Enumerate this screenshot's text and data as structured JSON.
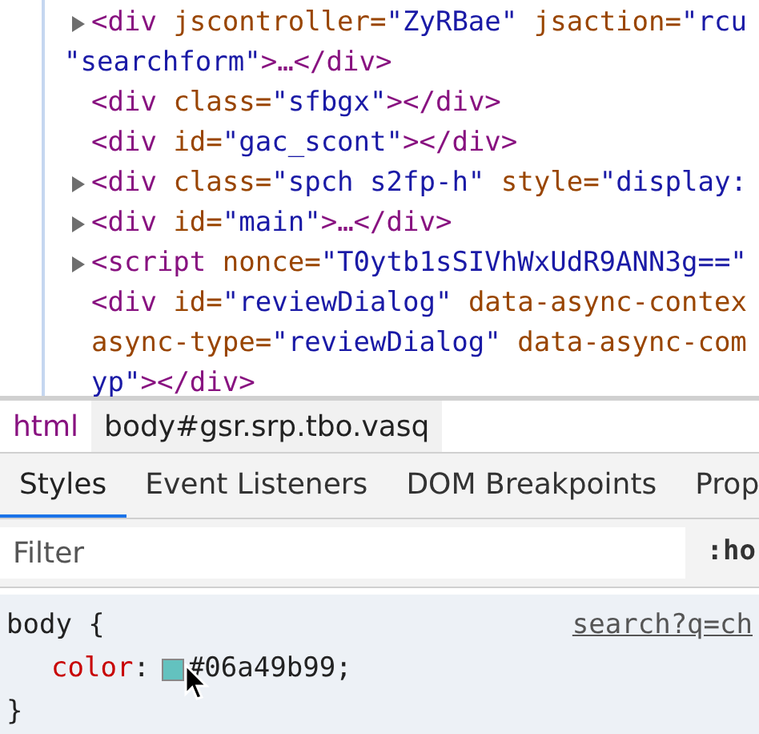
{
  "dom_lines": [
    {
      "arrow": true,
      "kind": "element",
      "tokens": [
        {
          "kind": "tag",
          "text": "<div"
        },
        {
          "kind": "attr",
          "text": " jscontroller="
        },
        {
          "kind": "value",
          "text": "\"ZyRBae\""
        },
        {
          "kind": "attr",
          "text": " jsaction="
        },
        {
          "kind": "value",
          "text": "\"rcu"
        }
      ]
    },
    {
      "arrow": false,
      "kind": "overflow",
      "tokens": [
        {
          "kind": "value",
          "text": "\"searchform\""
        },
        {
          "kind": "tag",
          "text": ">…</div>"
        }
      ]
    },
    {
      "arrow": false,
      "kind": "element",
      "tokens": [
        {
          "kind": "tag",
          "text": "<div"
        },
        {
          "kind": "attr",
          "text": " class="
        },
        {
          "kind": "value",
          "text": "\"sfbgx\""
        },
        {
          "kind": "tag",
          "text": "></div>"
        }
      ]
    },
    {
      "arrow": false,
      "kind": "element",
      "tokens": [
        {
          "kind": "tag",
          "text": "<div"
        },
        {
          "kind": "attr",
          "text": " id="
        },
        {
          "kind": "value",
          "text": "\"gac_scont\""
        },
        {
          "kind": "tag",
          "text": "></div>"
        }
      ]
    },
    {
      "arrow": true,
      "kind": "element",
      "tokens": [
        {
          "kind": "tag",
          "text": "<div"
        },
        {
          "kind": "attr",
          "text": " class="
        },
        {
          "kind": "value",
          "text": "\"spch s2fp-h\""
        },
        {
          "kind": "attr",
          "text": " style="
        },
        {
          "kind": "value",
          "text": "\"display:"
        }
      ]
    },
    {
      "arrow": true,
      "kind": "element",
      "tokens": [
        {
          "kind": "tag",
          "text": "<div"
        },
        {
          "kind": "attr",
          "text": " id="
        },
        {
          "kind": "value",
          "text": "\"main\""
        },
        {
          "kind": "tag",
          "text": ">…</div>"
        }
      ]
    },
    {
      "arrow": true,
      "kind": "element",
      "tokens": [
        {
          "kind": "tag",
          "text": "<script"
        },
        {
          "kind": "attr",
          "text": " nonce="
        },
        {
          "kind": "value",
          "text": "\"T0ytb1sSIVhWxUdR9ANN3g==\""
        }
      ]
    },
    {
      "arrow": false,
      "kind": "element",
      "tokens": [
        {
          "kind": "tag",
          "text": "<div"
        },
        {
          "kind": "attr",
          "text": " id="
        },
        {
          "kind": "value",
          "text": "\"reviewDialog\""
        },
        {
          "kind": "attr",
          "text": " data-async-contex"
        }
      ]
    },
    {
      "arrow": false,
      "kind": "continuation",
      "tokens": [
        {
          "kind": "attr",
          "text": "async-type="
        },
        {
          "kind": "value",
          "text": "\"reviewDialog\""
        },
        {
          "kind": "attr",
          "text": " data-async-com"
        }
      ]
    },
    {
      "arrow": false,
      "kind": "continuation",
      "tokens": [
        {
          "kind": "value",
          "text": "yp\""
        },
        {
          "kind": "tag",
          "text": "></div>"
        }
      ]
    }
  ],
  "breadcrumbs": [
    {
      "label": "html",
      "selected": false
    },
    {
      "label": "body#gsr.srp.tbo.vasq",
      "selected": true
    }
  ],
  "tabs": [
    {
      "label": "Styles",
      "selected": true
    },
    {
      "label": "Event Listeners",
      "selected": false
    },
    {
      "label": "DOM Breakpoints",
      "selected": false
    },
    {
      "label": "Prop",
      "selected": false
    }
  ],
  "filter": {
    "placeholder": "Filter",
    "pseudo_toggle": ":ho"
  },
  "rule": {
    "selector": "body {",
    "source": "search?q=ch",
    "property": "color",
    "colon": ":",
    "value": "#06a49b99;",
    "close": "}"
  }
}
